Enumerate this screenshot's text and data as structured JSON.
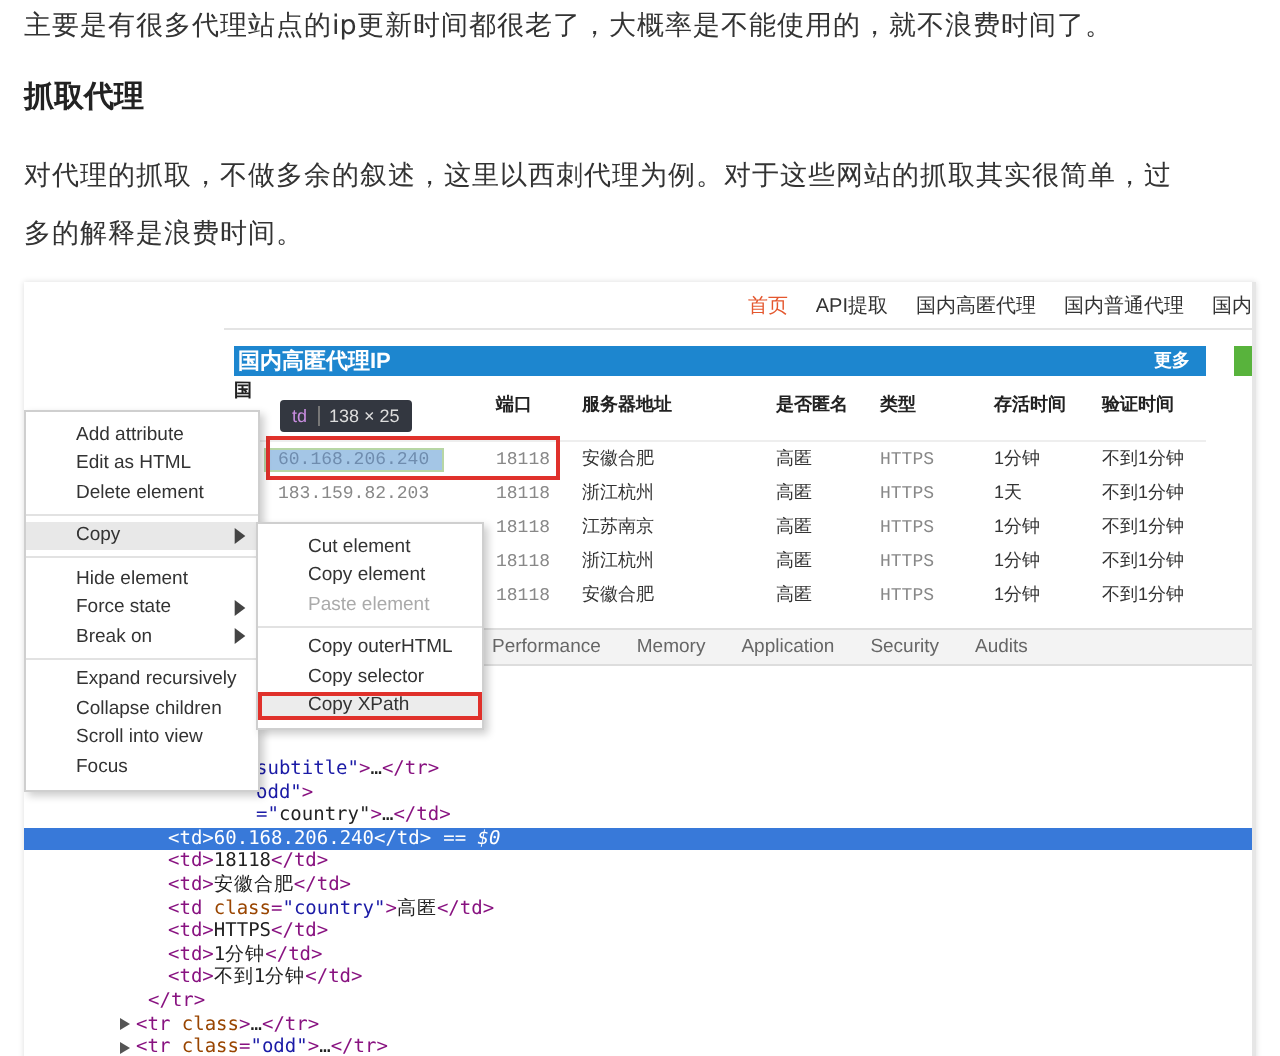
{
  "article": {
    "intro": "主要是有很多代理站点的ip更新时间都很老了，大概率是不能使用的，就不浪费时间了。",
    "heading": "抓取代理",
    "paragraph": "对代理的抓取，不做多余的叙述，这里以西刺代理为例。对于这些网站的抓取其实很简单，过多的解释是浪费时间。"
  },
  "screenshot": {
    "site": {
      "nav": [
        {
          "label": "首页",
          "selected": true
        },
        {
          "label": "API提取",
          "selected": false
        },
        {
          "label": "国内高匿代理",
          "selected": false
        },
        {
          "label": "国内普通代理",
          "selected": false
        },
        {
          "label": "国内",
          "selected": false
        }
      ],
      "panel": {
        "title": "国内高匿代理IP",
        "more": "更多",
        "columns": [
          {
            "text": "国"
          },
          {},
          {
            "text": "端口"
          },
          {
            "text": "服务器地址"
          },
          {
            "text": "是否匿名"
          },
          {
            "text": "类型"
          },
          {
            "text": "存活时间"
          },
          {
            "text": "验证时间"
          }
        ],
        "rows": [
          {
            "ip": "60.168.206.240",
            "port": "18118",
            "location": "安徽合肥",
            "anonymity": "高匿",
            "type": "HTTPS",
            "alive": "1分钟",
            "verified": "不到1分钟",
            "inspected": true
          },
          {
            "ip": "183.159.82.203",
            "port": "18118",
            "location": "浙江杭州",
            "anonymity": "高匿",
            "type": "HTTPS",
            "alive": "1天",
            "verified": "不到1分钟",
            "inspected": false
          },
          {
            "port": "18118",
            "location": "江苏南京",
            "anonymity": "高匿",
            "type": "HTTPS",
            "alive": "1分钟",
            "verified": "不到1分钟"
          },
          {
            "port": "18118",
            "location": "浙江杭州",
            "anonymity": "高匿",
            "type": "HTTPS",
            "alive": "1分钟",
            "verified": "不到1分钟"
          },
          {
            "port": "18118",
            "location": "安徽合肥",
            "anonymity": "高匿",
            "type": "HTTPS",
            "alive": "1分钟",
            "verified": "不到1分钟"
          }
        ]
      }
    },
    "tooltip": {
      "tag": "td",
      "size": "138 × 25"
    },
    "devtools": {
      "tabs": [
        "Performance",
        "Memory",
        "Application",
        "Security",
        "Audits"
      ],
      "elements": [
        {
          "kind": "tail",
          "text": "subtitle\">…</tr>"
        },
        {
          "kind": "tail",
          "text": "odd\">",
          "children": [
            {
              "kind": "tail",
              "text": "=\"country\">…</td>"
            },
            {
              "kind": "node",
              "text": "<td>60.168.206.240</td>",
              "note": "== $0",
              "selected": true
            },
            {
              "kind": "node",
              "text": "<td>18118</td>",
              "selected": false
            },
            {
              "kind": "node",
              "text": "<td>安徽合肥</td>",
              "selected": false
            },
            {
              "kind": "node",
              "text": "<td class=\"country\">高匿</td>",
              "selected": false
            },
            {
              "kind": "node",
              "text": "<td>HTTPS</td>",
              "selected": false
            },
            {
              "kind": "node",
              "text": "<td>1分钟</td>",
              "selected": false
            },
            {
              "kind": "node",
              "text": "<td>不到1分钟</td>",
              "selected": false
            }
          ]
        },
        {
          "kind": "node",
          "text": "</tr>",
          "selected": false
        },
        {
          "kind": "root",
          "text": "<tr class>…</tr>",
          "expanded": false,
          "selected": false
        },
        {
          "kind": "root",
          "text": "<tr class=\"odd\">…</tr>",
          "expanded": false,
          "selected": false
        }
      ]
    },
    "context_menu": {
      "groups": [
        [
          {
            "label": "Add attribute",
            "kind": "action",
            "selected": false
          },
          {
            "label": "Edit as HTML",
            "kind": "action",
            "selected": false
          },
          {
            "label": "Delete element",
            "kind": "action",
            "selected": false
          }
        ],
        [
          {
            "label": "Copy",
            "kind": "submenu",
            "selected": true
          }
        ],
        [
          {
            "label": "Hide element",
            "kind": "action",
            "selected": false
          },
          {
            "label": "Force state",
            "kind": "submenu",
            "selected": false
          },
          {
            "label": "Break on",
            "kind": "submenu",
            "selected": false
          }
        ],
        [
          {
            "label": "Expand recursively",
            "kind": "action",
            "selected": false
          },
          {
            "label": "Collapse children",
            "kind": "action",
            "selected": false
          },
          {
            "label": "Scroll into view",
            "kind": "action",
            "selected": false
          },
          {
            "label": "Focus",
            "kind": "action",
            "selected": false
          }
        ]
      ]
    },
    "copy_submenu": {
      "groups": [
        [
          {
            "label": "Cut element",
            "disabled": false,
            "selected": false
          },
          {
            "label": "Copy element",
            "disabled": false,
            "selected": false
          },
          {
            "label": "Paste element",
            "disabled": true,
            "selected": false
          }
        ],
        [
          {
            "label": "Copy outerHTML",
            "disabled": false,
            "selected": false
          },
          {
            "label": "Copy selector",
            "disabled": false,
            "selected": false
          },
          {
            "label": "Copy XPath",
            "disabled": false,
            "selected": true
          }
        ]
      ]
    }
  }
}
